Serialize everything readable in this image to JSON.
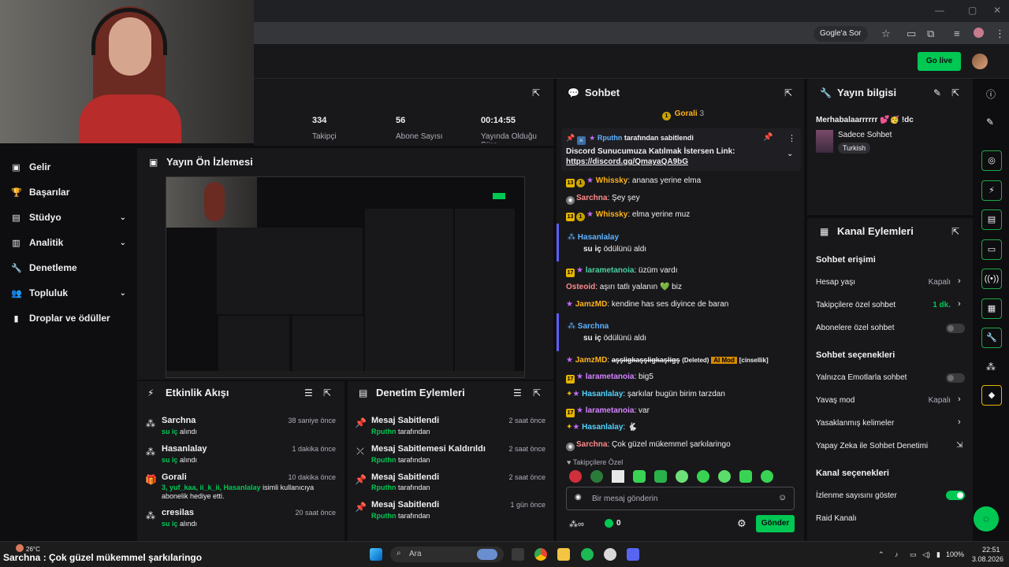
{
  "browser": {
    "search_pill": "Gogle'a Sor"
  },
  "topbar": {
    "go_live_label": "Go live"
  },
  "sidebar": {
    "items": [
      {
        "label": "Gelir",
        "icon": "wallet-icon",
        "expandable": false
      },
      {
        "label": "Başarılar",
        "icon": "trophy-icon",
        "expandable": false
      },
      {
        "label": "Stüdyo",
        "icon": "studio-icon",
        "expandable": true
      },
      {
        "label": "Analitik",
        "icon": "analytics-icon",
        "expandable": true
      },
      {
        "label": "Denetleme",
        "icon": "wrench-icon",
        "expandable": false
      },
      {
        "label": "Topluluk",
        "icon": "community-icon",
        "expandable": true
      },
      {
        "label": "Droplar ve ödüller",
        "icon": "drops-icon",
        "expandable": false
      }
    ]
  },
  "stats": [
    {
      "value": "334",
      "label": "Takipçi"
    },
    {
      "value": "56",
      "label": "Abone Sayısı"
    },
    {
      "value": "00:14:55",
      "label": "Yayında Olduğu Süre"
    }
  ],
  "preview": {
    "title": "Yayın Ön İzlemesi"
  },
  "activity": {
    "title": "Etkinlik Akışı",
    "items": [
      {
        "name": "Sarchna",
        "detail": "su iç",
        "suffix": "alındı",
        "time": "38 saniye önce"
      },
      {
        "name": "Hasanlalay",
        "detail": "su iç",
        "suffix": "alındı",
        "time": "1 dakika önce"
      },
      {
        "name": "Gorali",
        "detail": "3, yuf_kaa, ii_k_ii, Hasanlalay",
        "suffix": "isimli kullanıcıya abonelik hediye etti.",
        "time": "10 dakika önce"
      },
      {
        "name": "cresilas",
        "detail": "su iç",
        "suffix": "alındı",
        "time": "20 saat önce"
      }
    ]
  },
  "modlog": {
    "title": "Denetim Eylemleri",
    "items": [
      {
        "name": "Mesaj Sabitlendi",
        "by": "Rputhn",
        "suffix": "tarafından",
        "time": "2 saat önce"
      },
      {
        "name": "Mesaj Sabitlemesi Kaldırıldı",
        "by": "Rputhn",
        "suffix": "tarafından",
        "time": "2 saat önce"
      },
      {
        "name": "Mesaj Sabitlendi",
        "by": "Rputhn",
        "suffix": "tarafından",
        "time": "2 saat önce"
      },
      {
        "name": "Mesaj Sabitlendi",
        "by": "Rputhn",
        "suffix": "tarafından",
        "time": "1 gün önce"
      }
    ]
  },
  "chat": {
    "title": "Sohbet",
    "gifter": {
      "name": "Gorali",
      "count": "3"
    },
    "pinned": {
      "by": "Rputhn",
      "by_suffix": "tarafından sabitlendi",
      "message": "Discord Sunucumuza Katılmak İstersen Link:",
      "link": "https://discord.gg/QmayaQA9bG"
    },
    "messages": [
      {
        "user": "Whissky",
        "text": "ananas yerine elma"
      },
      {
        "user": "Sarchna",
        "text": "Şey şey"
      },
      {
        "user": "Whissky",
        "text": "elma yerine muz"
      },
      {
        "user": "Hasanlalay",
        "text": "su iç",
        "redeem": "ödülünü aldı"
      },
      {
        "user": "larametanoia",
        "text": "üzüm vardı"
      },
      {
        "user": "Osteoid",
        "text": "aşırı tatlı yalanın 💚 biz"
      },
      {
        "user": "JamzMD",
        "text": "kendine has ses diyince de baran"
      },
      {
        "user": "Sarchna",
        "text": "su iç",
        "redeem": "ödülünü aldı"
      },
      {
        "user": "JamzMD",
        "text": "aşşligkaşşligkaşligş",
        "deleted": "(Deleted)",
        "mod_tag": "AI Mod",
        "reason": "[cinsellik]"
      },
      {
        "user": "larametanoia",
        "text": "big5"
      },
      {
        "user": "Hasanlalay",
        "text": "şarkılar bugün birim tarzdan"
      },
      {
        "user": "larametanoia",
        "text": "var"
      },
      {
        "user": "Hasanlalay",
        "text": "🐇"
      },
      {
        "user": "Sarchna",
        "text": "Çok güzel mükemmel şarkılaringo"
      }
    ],
    "follower_only_label": "Takipçilere Özel",
    "input_placeholder": "Bir mesaj gönderin",
    "points": "0",
    "send_label": "Gönder"
  },
  "stream_info": {
    "title": "Yayın bilgisi",
    "stream_title": "Merhabalaarrrrrr 💕🥳 !dc",
    "category": "Sadece Sohbet",
    "language_tag": "Turkish"
  },
  "channel_actions": {
    "title": "Kanal Eylemleri",
    "chat_access_heading": "Sohbet erişimi",
    "account_age_label": "Hesap yaşı",
    "account_age_value": "Kapalı",
    "follower_chat_label": "Takipçilere özel sohbet",
    "follower_chat_value": "1 dk.",
    "sub_chat_label": "Abonelere özel sohbet",
    "chat_options_heading": "Sohbet seçenekleri",
    "emote_only_label": "Yalnızca Emotlarla sohbet",
    "slow_mode_label": "Yavaş mod",
    "slow_mode_value": "Kapalı",
    "banned_words_label": "Yasaklanmış kelimeler",
    "ai_mod_label": "Yapay Zeka ile Sohbet Denetimi",
    "channel_options_heading": "Kanal seçenekleri",
    "viewer_count_label": "İzlenme sayısını göster",
    "raid_label": "Raid Kanalı"
  },
  "taskbar": {
    "ticker": "Sarchna : Çok güzel mükemmel şarkılaringo",
    "weather": "26°C",
    "search_placeholder": "Ara",
    "battery": "100%",
    "time": "22:51",
    "date": "3.08.2026"
  },
  "colors": {
    "accent": "#00c853",
    "panel_bg": "#18181b",
    "page_bg": "#0e0e10"
  }
}
